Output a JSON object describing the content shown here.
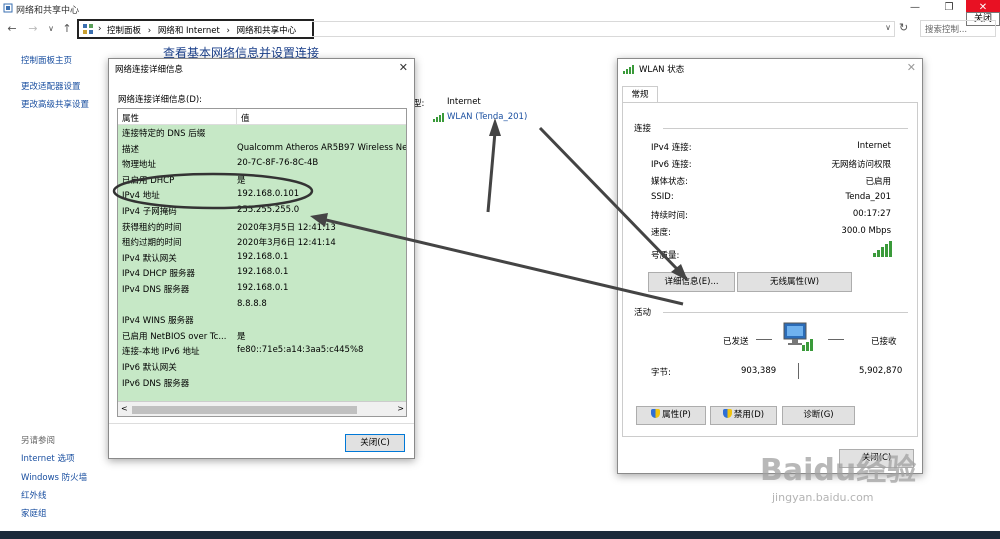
{
  "window": {
    "title": "网络和共享中心",
    "minimize": "—",
    "maximize": "❐",
    "close": "✕",
    "tooltip": "关闭"
  },
  "nav": {
    "back": "←",
    "forward": "→",
    "dropdown": "∨",
    "up": "↑",
    "breadcrumb": [
      "控制面板",
      "网络和 Internet",
      "网络和共享中心"
    ],
    "sep": "›",
    "refresh": "↻",
    "search_placeholder": "搜索控制..."
  },
  "left_pane": {
    "items": [
      "控制面板主页",
      "更改适配器设置",
      "更改高级共享设置"
    ],
    "see_also_title": "另请参阅",
    "see_also": [
      "Internet 选项",
      "Windows 防火墙",
      "红外线",
      "家庭组"
    ]
  },
  "main": {
    "heading": "查看基本网络信息并设置连接",
    "access_type_label": "型:",
    "access_type_value": "Internet",
    "connection_link": "WLAN (Tenda_201)"
  },
  "details_dialog": {
    "title": "网络连接详细信息",
    "subtitle": "网络连接详细信息(D):",
    "col_property": "属性",
    "col_value": "值",
    "rows": [
      {
        "label": "连接特定的 DNS 后缀",
        "value": ""
      },
      {
        "label": "描述",
        "value": "Qualcomm Atheros AR5B97 Wireless Ne"
      },
      {
        "label": "物理地址",
        "value": "20-7C-8F-76-8C-4B"
      },
      {
        "label": "已启用 DHCP",
        "value": "是"
      },
      {
        "label": "IPv4 地址",
        "value": "192.168.0.101"
      },
      {
        "label": "IPv4 子网掩码",
        "value": "255.255.255.0"
      },
      {
        "label": "获得租约的时间",
        "value": "2020年3月5日 12:41:13"
      },
      {
        "label": "租约过期的时间",
        "value": "2020年3月6日 12:41:14"
      },
      {
        "label": "IPv4 默认网关",
        "value": "192.168.0.1"
      },
      {
        "label": "IPv4 DHCP 服务器",
        "value": "192.168.0.1"
      },
      {
        "label": "IPv4 DNS 服务器",
        "value": "192.168.0.1"
      },
      {
        "label": "",
        "value": "8.8.8.8"
      },
      {
        "label": "IPv4 WINS 服务器",
        "value": ""
      },
      {
        "label": "已启用 NetBIOS over Tc...",
        "value": "是"
      },
      {
        "label": "连接-本地 IPv6 地址",
        "value": "fe80::71e5:a14:3aa5:c445%8"
      },
      {
        "label": "IPv6 默认网关",
        "value": ""
      },
      {
        "label": "IPv6 DNS 服务器",
        "value": ""
      }
    ],
    "scroll_left": "<",
    "scroll_right": ">",
    "close_button": "关闭(C)"
  },
  "wlan_dialog": {
    "title": "WLAN 状态",
    "tab": "常规",
    "connection_section": "连接",
    "fields": [
      {
        "label": "IPv4 连接:",
        "value": "Internet"
      },
      {
        "label": "IPv6 连接:",
        "value": "无网络访问权限"
      },
      {
        "label": "媒体状态:",
        "value": "已启用"
      },
      {
        "label": "SSID:",
        "value": "Tenda_201"
      },
      {
        "label": "持续时间:",
        "value": "00:17:27"
      },
      {
        "label": "速度:",
        "value": "300.0 Mbps"
      }
    ],
    "signal_label": "号质量:",
    "details_button": "详细信息(E)...",
    "wireless_props_button": "无线属性(W)",
    "activity_section": "活动",
    "sent_label": "已发送",
    "received_label": "已接收",
    "bytes_label": "字节:",
    "bytes_sent": "903,389",
    "bytes_received": "5,902,870",
    "properties_button": "属性(P)",
    "disable_button": "禁用(D)",
    "diagnose_button": "诊断(G)",
    "close_button": "关闭(C)"
  },
  "watermark": {
    "text": "Baidu经验",
    "url": "jingyan.baidu.com"
  },
  "colors": {
    "accent": "#1a4fa0",
    "list_highlight": "#c6e8c6",
    "close_red": "#e81123"
  }
}
